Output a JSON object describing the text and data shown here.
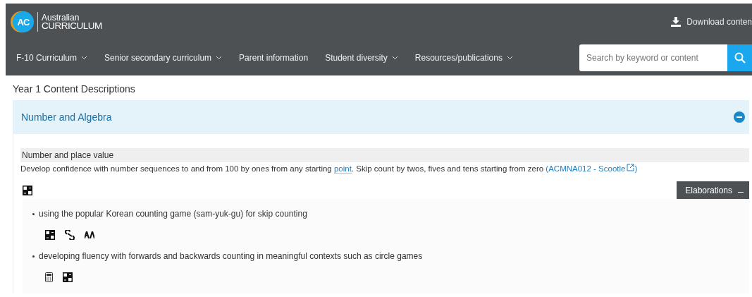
{
  "header": {
    "logo_badge": "AC",
    "logo_line1": "Australian",
    "logo_line2": "CURRICULUM",
    "download": "Download conten"
  },
  "nav": [
    {
      "label": "F-10 Curriculum",
      "dropdown": true
    },
    {
      "label": "Senior secondary curriculum",
      "dropdown": true
    },
    {
      "label": "Parent information",
      "dropdown": false
    },
    {
      "label": "Student diversity",
      "dropdown": true
    },
    {
      "label": "Resources/publications",
      "dropdown": true
    }
  ],
  "search": {
    "placeholder": "Search by keyword or content"
  },
  "page_title": "Year 1 Content Descriptions",
  "strand": {
    "title": "Number and Algebra",
    "expanded": true
  },
  "sub_strand": "Number and place value",
  "description": {
    "before": "Develop confidence with number sequences to and from 100 by ones from any starting ",
    "glossary_link": "point",
    "after": ". Skip count by twos, fives and tens starting from zero ",
    "code_open": "(",
    "code_link": "ACMNA012 - Scootle",
    "code_close": ")"
  },
  "description_icons": [
    {
      "kind": "grid"
    }
  ],
  "elaborations_button": {
    "label": "Elaborations",
    "expanded": true
  },
  "elaborations": [
    {
      "text": "using the popular Korean counting game (sam-yuk-gu) for skip counting",
      "icons": [
        {
          "kind": "grid"
        },
        {
          "kind": "link"
        },
        {
          "kind": "letters"
        }
      ]
    },
    {
      "text": "developing fluency with forwards and backwards counting in meaningful contexts such as circle games",
      "icons": [
        {
          "kind": "calculator"
        },
        {
          "kind": "grid"
        }
      ]
    }
  ]
}
